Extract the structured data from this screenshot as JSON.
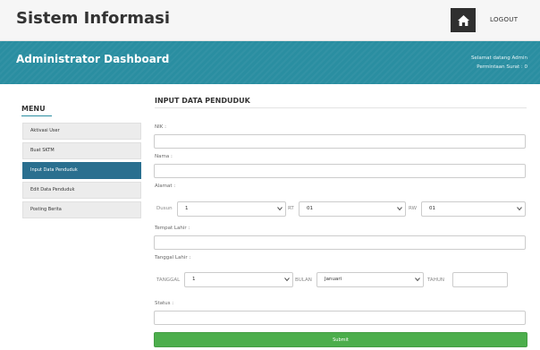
{
  "header": {
    "brand": "Sistem Informasi",
    "home_icon": "home-icon",
    "logout_label": "LOGOUT"
  },
  "banner": {
    "title": "Administrator Dashboard",
    "welcome": "Selamat datang Admin",
    "requests": "Permintaan Surat : 0"
  },
  "sidebar": {
    "title": "MENU",
    "items": [
      {
        "label": "Aktivasi User",
        "active": false
      },
      {
        "label": "Buat SKTM",
        "active": false
      },
      {
        "label": "Input Data Penduduk",
        "active": true
      },
      {
        "label": "Edit Data Penduduk",
        "active": false
      },
      {
        "label": "Posting Berita",
        "active": false
      }
    ]
  },
  "form": {
    "title": "INPUT DATA PENDUDUK",
    "nik_label": "NIK :",
    "nama_label": "Nama :",
    "alamat_label": "Alamat :",
    "dusun_label": "Dusun",
    "dusun_value": "1",
    "rt_label": "RT",
    "rt_value": "01",
    "rw_label": "RW",
    "rw_value": "01",
    "tempat_label": "Tempat Lahir :",
    "tanggal_label": "Tanggal Lahir :",
    "tgl_label": "TANGGAL",
    "tgl_value": "1",
    "bulan_label": "BULAN",
    "bulan_value": "Januari",
    "tahun_label": "TAHUN",
    "status_label": "Status :",
    "submit_label": "Submit"
  },
  "colors": {
    "accent": "#2a8ea1",
    "active_menu": "#2a6f8f",
    "submit": "#4cae4c"
  }
}
